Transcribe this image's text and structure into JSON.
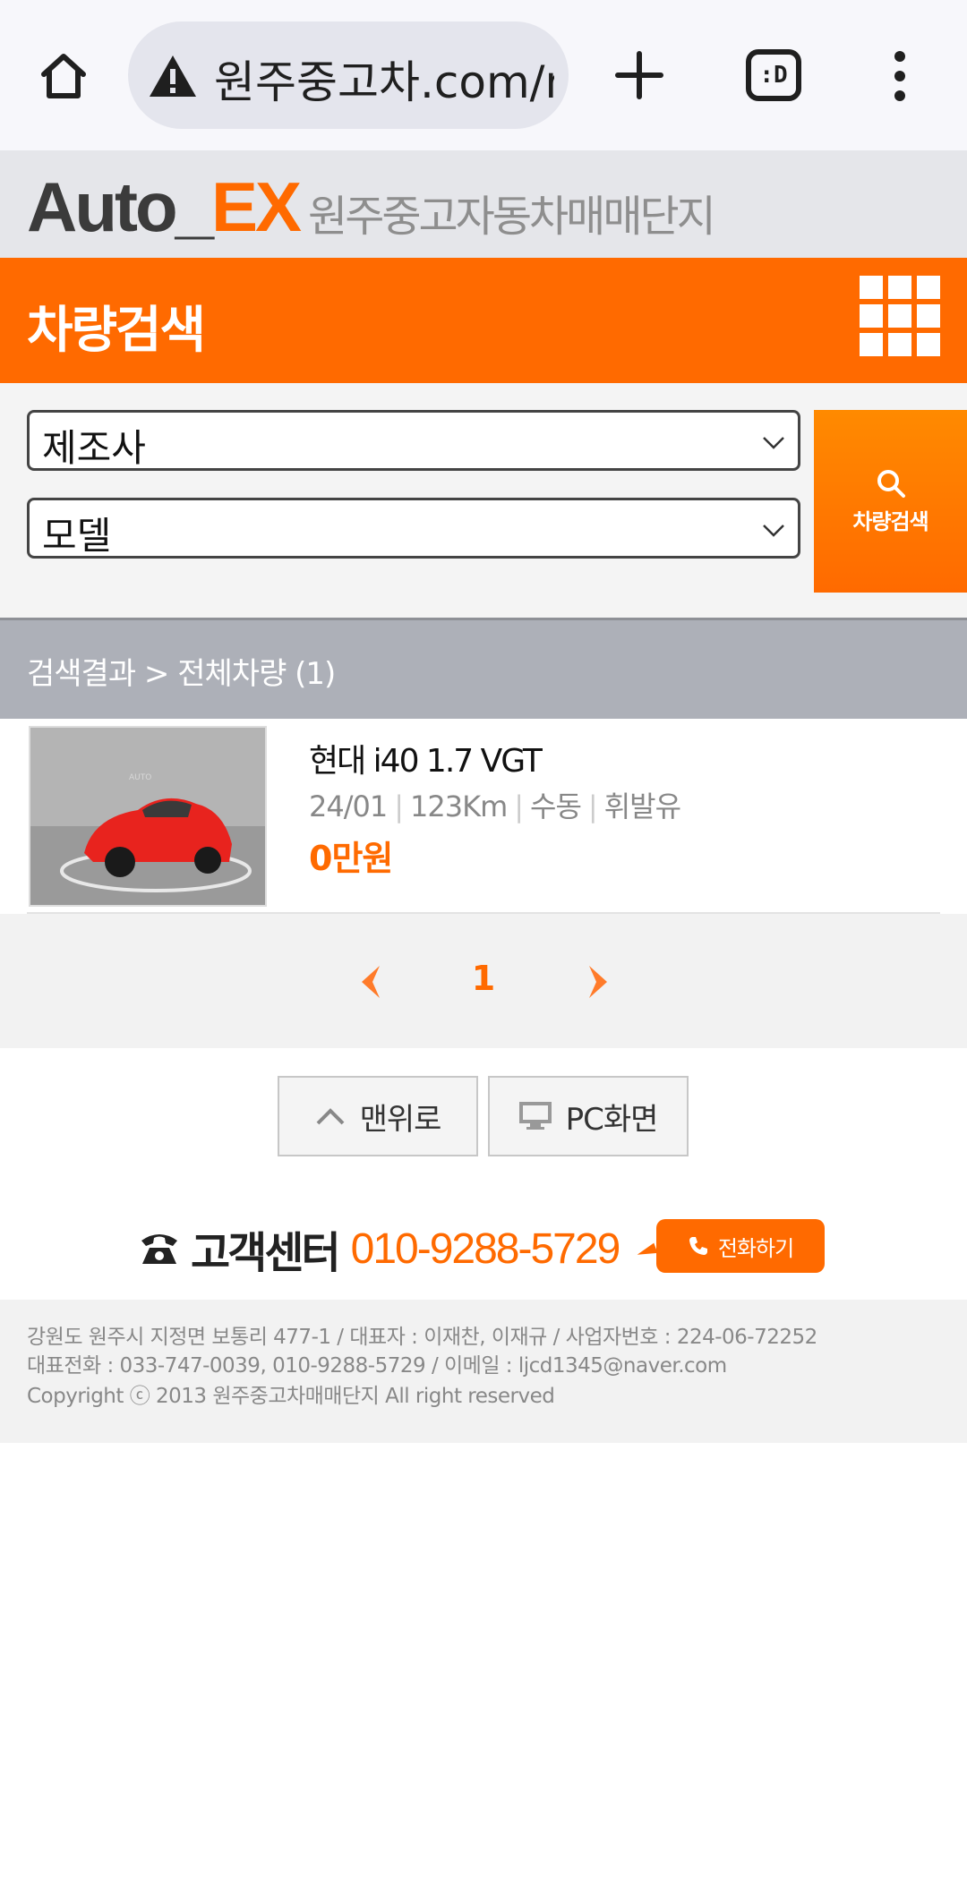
{
  "browser": {
    "url": "원주중고차.com/m",
    "tabs_label": ":D"
  },
  "header": {
    "logo_auto": "Auto_",
    "logo_ex": "EX",
    "logo_sub": "원주중고자동차매매단지"
  },
  "title_bar": {
    "title": "차량검색"
  },
  "search": {
    "maker_selected": "제조사",
    "model_selected": "모델",
    "button_label": "차량검색"
  },
  "results": {
    "breadcrumb": "검색결과 > 전체차량 (1)"
  },
  "listings": [
    {
      "name": "현대 i40 1.7 VGT",
      "date": "24/01",
      "mileage": "123Km",
      "transmission": "수동",
      "fuel": "휘발유",
      "price": "0만원"
    }
  ],
  "pagination": {
    "current": "1"
  },
  "footer_buttons": {
    "top": "맨위로",
    "pc": "PC화면"
  },
  "customer_center": {
    "label": "고객센터",
    "phone": "010-9288-5729",
    "call_button": "전화하기"
  },
  "footer": {
    "line1": "강원도 원주시 지정면 보통리 477-1 / 대표자 : 이재찬, 이재규 / 사업자번호 : 224-06-72252",
    "line2": "대표전화 : 033-747-0039, 010-9288-5729 / 이메일 : ljcd1345@naver.com",
    "line3": "Copyright ⓒ 2013 원주중고차매매단지 All right reserved"
  },
  "colors": {
    "accent": "#ff6a00",
    "header_bg": "#e5e6ea",
    "results_bg": "#adb0b8"
  }
}
